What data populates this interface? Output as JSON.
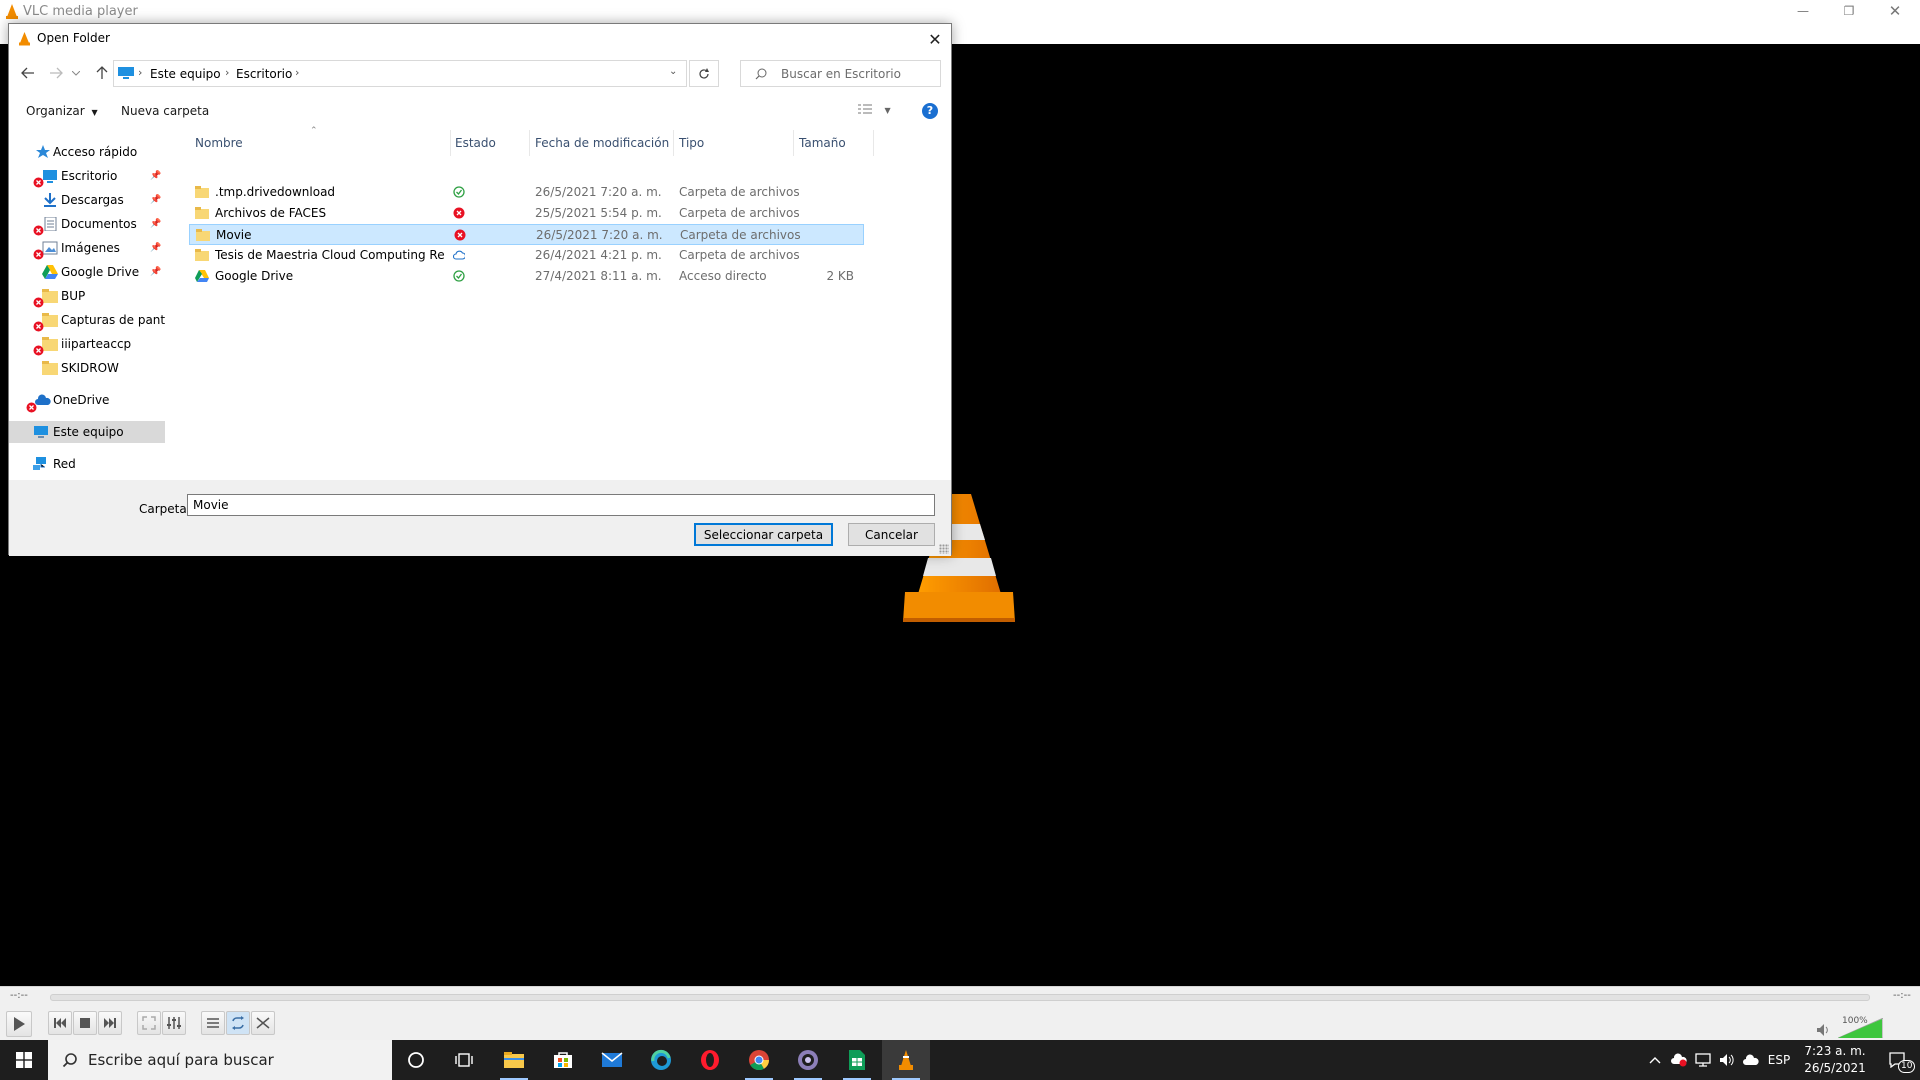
{
  "vlc": {
    "title": "VLC media player",
    "time_elapsed": "--:--",
    "time_remaining": "--:--",
    "volume": "100%"
  },
  "dialog": {
    "title": "Open Folder",
    "breadcrumbs": [
      "Este equipo",
      "Escritorio"
    ],
    "search_placeholder": "Buscar en Escritorio",
    "toolbar": {
      "organize": "Organizar",
      "new_folder": "Nueva carpeta"
    },
    "nav_items": [
      {
        "label": "Acceso rápido",
        "icon": "star-icon"
      },
      {
        "label": "Escritorio",
        "icon": "desktop-icon"
      },
      {
        "label": "Descargas",
        "icon": "download-icon"
      },
      {
        "label": "Documentos",
        "icon": "document-icon"
      },
      {
        "label": "Imágenes",
        "icon": "image-icon"
      },
      {
        "label": "Google Drive",
        "icon": "google-drive-icon"
      },
      {
        "label": "BUP",
        "icon": "folder-icon"
      },
      {
        "label": "Capturas de pantall",
        "icon": "folder-icon"
      },
      {
        "label": "iiiparteaccp",
        "icon": "folder-icon"
      },
      {
        "label": "SKIDROW",
        "icon": "folder-icon"
      },
      {
        "label": "OneDrive",
        "icon": "cloud-icon"
      },
      {
        "label": "Este equipo",
        "icon": "computer-icon"
      },
      {
        "label": "Red",
        "icon": "network-icon"
      }
    ],
    "columns": {
      "name": "Nombre",
      "status": "Estado",
      "modified": "Fecha de modificación",
      "type": "Tipo",
      "size": "Tamaño"
    },
    "files": [
      {
        "name": ".tmp.drivedownload",
        "status": "synced",
        "modified": "26/5/2021 7:20 a. m.",
        "type": "Carpeta de archivos",
        "size": ""
      },
      {
        "name": "Archivos de FACES",
        "status": "error",
        "modified": "25/5/2021 5:54 p. m.",
        "type": "Carpeta de archivos",
        "size": ""
      },
      {
        "name": "Movie",
        "status": "error",
        "modified": "26/5/2021 7:20 a. m.",
        "type": "Carpeta de archivos",
        "size": ""
      },
      {
        "name": "Tesis de Maestria Cloud Computing Revis...",
        "status": "cloud",
        "modified": "26/4/2021 4:21 p. m.",
        "type": "Carpeta de archivos",
        "size": ""
      },
      {
        "name": "Google Drive",
        "status": "synced",
        "modified": "27/4/2021 8:11 a. m.",
        "type": "Acceso directo",
        "size": "2 KB"
      }
    ],
    "folder_label": "Carpeta:",
    "folder_value": "Movie",
    "select_button": "Seleccionar carpeta",
    "cancel_button": "Cancelar"
  },
  "taskbar": {
    "search_placeholder": "Escribe aquí para buscar",
    "language": "ESP",
    "time": "7:23 a. m.",
    "date": "26/5/2021",
    "notifications": "10"
  },
  "colors": {
    "accent": "#0078d7",
    "selection": "#cce8ff",
    "vlc_orange": "#f28c00",
    "error": "#e81123",
    "synced": "#2ea043"
  }
}
